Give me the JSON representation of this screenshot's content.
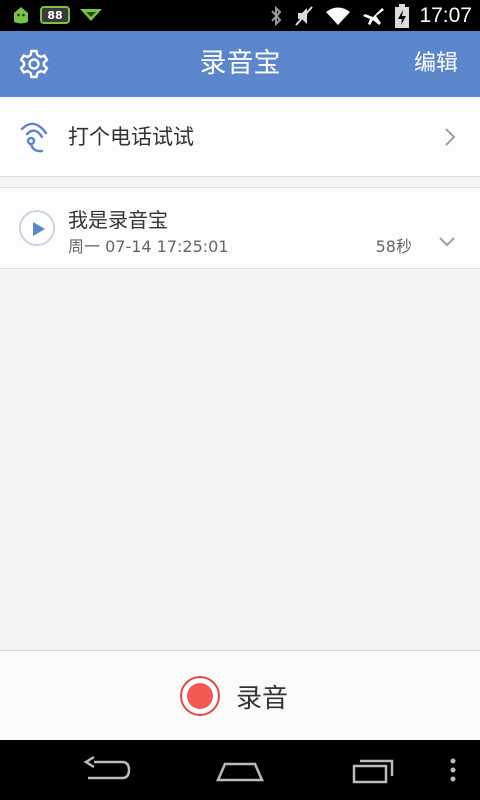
{
  "status_bar": {
    "battery_badge": "88",
    "time": "17:07",
    "icons": [
      "android-icon",
      "battery-badge-icon",
      "download-icon",
      "bluetooth-icon",
      "mute-icon",
      "wifi-icon",
      "airplane-icon",
      "battery-charging-icon"
    ]
  },
  "header": {
    "title": "录音宝",
    "edit_label": "编辑",
    "settings_icon": "gear-icon",
    "background": "#5b86cc"
  },
  "call_row": {
    "label": "打个电话试试",
    "icon": "phone-wave-icon"
  },
  "recordings": [
    {
      "title": "我是录音宝",
      "date": "周一 07-14  17:25:01",
      "duration": "58秒"
    }
  ],
  "bottom_bar": {
    "record_label": "录音",
    "record_color": "#f05a50"
  },
  "nav_bar": {
    "icons": [
      "back-icon",
      "home-icon",
      "recent-apps-icon",
      "menu-icon"
    ]
  }
}
